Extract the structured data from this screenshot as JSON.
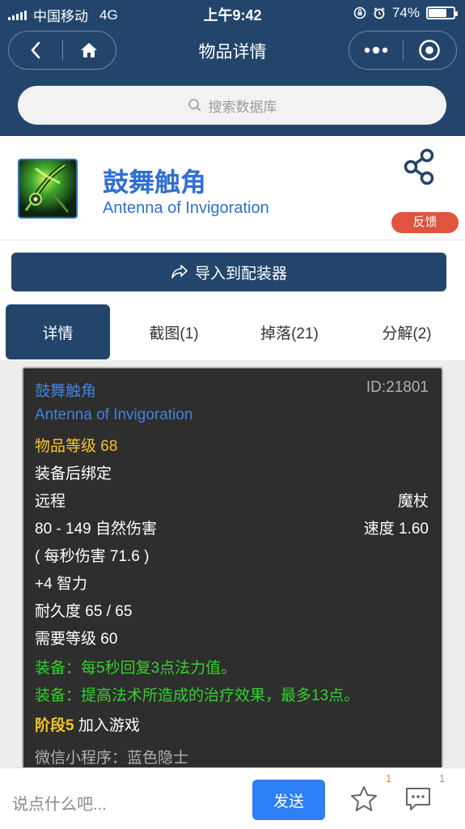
{
  "status_bar": {
    "carrier": "中国移动",
    "network": "4G",
    "time": "上午9:42",
    "battery_text": "74%",
    "battery_level": 0.74
  },
  "navbar": {
    "title": "物品详情",
    "icons": [
      "back-icon",
      "home-icon",
      "more-dots-icon",
      "target-icon"
    ]
  },
  "search": {
    "placeholder": "搜索数据库"
  },
  "item": {
    "name_cn": "鼓舞触角",
    "name_en": "Antenna of Invigoration",
    "feedback_label": "反馈"
  },
  "import_button": {
    "label": "导入到配装器"
  },
  "tabs": [
    {
      "label": "详情",
      "active": true
    },
    {
      "label": "截图(1)",
      "active": false
    },
    {
      "label": "掉落(21)",
      "active": false
    },
    {
      "label": "分解(2)",
      "active": false
    }
  ],
  "tooltip": {
    "name_cn": "鼓舞触角",
    "id_text": "ID:21801",
    "name_en": "Antenna of Invigoration",
    "item_level": "物品等级 68",
    "bind": "装备后绑定",
    "slot": "远程",
    "type": "魔杖",
    "damage": "80 - 149 自然伤害",
    "speed": "速度 1.60",
    "dps": "( 每秒伤害 71.6 )",
    "stat": "+4 智力",
    "durability": "耐久度 65 / 65",
    "required_level": "需要等级 60",
    "equip_1": "装备：每5秒回复3点法力值。",
    "equip_2": "装备：提高法术所造成的治疗效果，最多13点。",
    "phase_label": "阶段5",
    "phase_text": " 加入游戏",
    "source": "微信小程序：蓝色隐士"
  },
  "bottom_bar": {
    "comment_placeholder": "说点什么吧...",
    "send_label": "发送",
    "favorite_count": "1",
    "comment_count": "1"
  },
  "colors": {
    "header_bg": "#23456c",
    "accent_blue": "#2f6fd1",
    "feedback_red": "#e0533f",
    "send_blue": "#2c7ff4",
    "tooltip_gold": "#f6c325",
    "tooltip_green": "#33d12d"
  }
}
